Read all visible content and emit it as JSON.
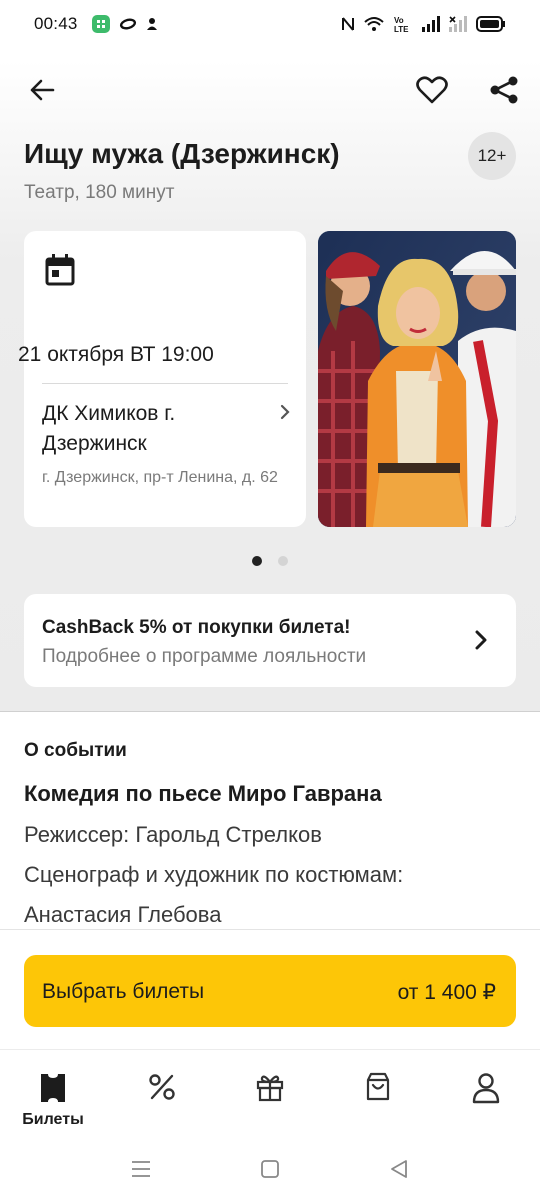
{
  "status_bar": {
    "time": "00:43",
    "volte": "Vo LTE"
  },
  "event": {
    "title": "Ищу мужа (Дзержинск)",
    "age": "12+",
    "subtitle": "Театр, 180 минут",
    "date": "21 октября ВТ 19:00",
    "venue_name": "ДК Химиков г. Дзержинск",
    "venue_address": "г. Дзержинск, пр-т Ленина, д. 62"
  },
  "carousel": {
    "count": 2,
    "active": 0
  },
  "cashback": {
    "title": "CashBack 5% от покупки билета!",
    "subtitle": "Подробнее о программе лояльности"
  },
  "about": {
    "heading": "О событии",
    "title": "Комедия по пьесе Миро Гаврана",
    "lines": [
      "Режиссер: Гарольд Стрелков",
      "Сценограф и художник по костюмам:",
      "Анастасия Глебова"
    ]
  },
  "buy": {
    "label": "Выбрать билеты",
    "price": "от 1 400 ₽"
  },
  "tabs": [
    {
      "label": "Билеты",
      "icon": "ticket-icon",
      "active": true
    },
    {
      "label": "",
      "icon": "percent-icon"
    },
    {
      "label": "",
      "icon": "gift-icon"
    },
    {
      "label": "",
      "icon": "bag-icon"
    },
    {
      "label": "",
      "icon": "profile-icon"
    }
  ],
  "colors": {
    "accent": "#fdc607",
    "text": "#1c1c1c",
    "secondary": "#7a7a7a"
  }
}
